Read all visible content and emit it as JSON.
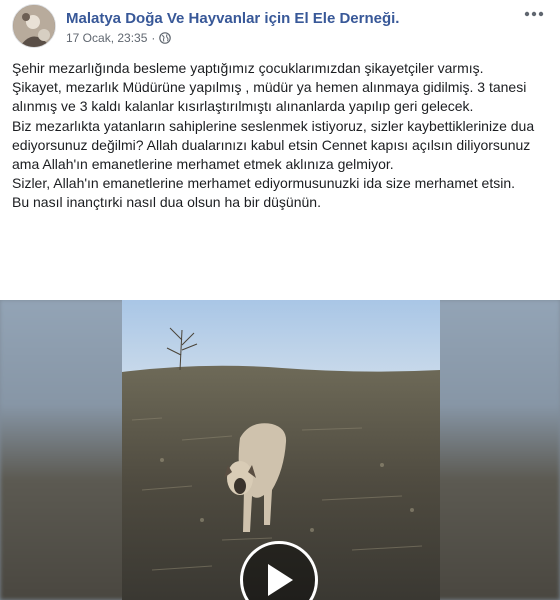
{
  "post": {
    "page_name": "Malatya Doğa Ve Hayvanlar için El Ele Derneği.",
    "timestamp": "17 Ocak, 23:35",
    "separator": "·",
    "privacy_icon": "globe-icon",
    "more_icon": "more-options-icon",
    "text_lines": [
      "Şehir mezarlığında besleme yaptığımız çocuklarımızdan şikayetçiler varmış.",
      "Şikayet, mezarlık Müdürüne yapılmış , müdür ya hemen alınmaya gidilmiş. 3 tanesi alınmış ve 3 kaldı kalanlar kısırlaştırılmıştı alınanlarda yapılıp geri gelecek.",
      "Biz mezarlıkta yatanların sahiplerine seslenmek istiyoruz, sizler kaybettiklerinize dua ediyorsunuz değilmi? Allah dualarınızı kabul etsin Cennet kapısı açılsın diliyorsunuz ama Allah'ın emanetlerine merhamet etmek aklınıza gelmiyor.",
      "Sizler, Allah'ın emanetlerine merhamet ediyormusunuzki ida size merhamet etsin.",
      "Bu nasıl inançtırki nasıl dua olsun ha bir düşünün."
    ]
  },
  "video": {
    "play_icon": "play-icon"
  },
  "colors": {
    "page_name": "#385898",
    "meta": "#606770",
    "text": "#1c1e21"
  }
}
